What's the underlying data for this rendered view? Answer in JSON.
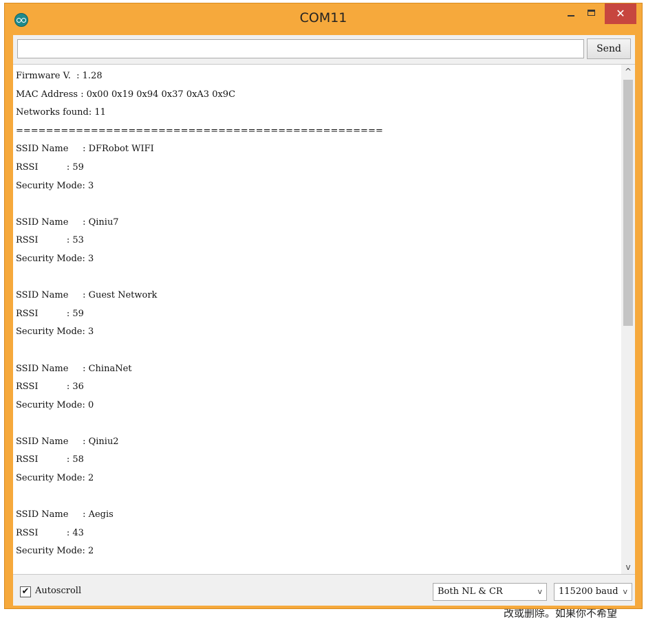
{
  "window": {
    "title": "COM11",
    "minimize_label": "–",
    "close_label": "✕"
  },
  "send": {
    "input_value": "",
    "button_label": "Send"
  },
  "output": {
    "lines": [
      "Firmware V.  : 1.28",
      "MAC Address : 0x00 0x19 0x94 0x37 0xA3 0x9C",
      "Networks found: 11",
      "=================================================",
      "SSID Name     : DFRobot WIFI",
      "RSSI          : 59",
      "Security Mode: 3",
      "",
      "SSID Name     : Qiniu7",
      "RSSI          : 53",
      "Security Mode: 3",
      "",
      "SSID Name     : Guest Network",
      "RSSI          : 59",
      "Security Mode: 3",
      "",
      "SSID Name     : ChinaNet",
      "RSSI          : 36",
      "Security Mode: 0",
      "",
      "SSID Name     : Qiniu2",
      "RSSI          : 58",
      "Security Mode: 2",
      "",
      "SSID Name     : Aegis",
      "RSSI          : 43",
      "Security Mode: 2"
    ]
  },
  "scrollbar": {
    "up_icon": "chevron-up-icon",
    "down_icon": "chevron-down-icon"
  },
  "status": {
    "autoscroll_label": "Autoscroll",
    "autoscroll_checked": true,
    "line_ending": "Both NL & CR",
    "baud_rate": "115200 baud"
  },
  "background_text": "改或删除。如果你不希望",
  "colors": {
    "title_bar": "#f6a93c",
    "close_button": "#c7463f",
    "app_icon": "#1f8a8c"
  }
}
